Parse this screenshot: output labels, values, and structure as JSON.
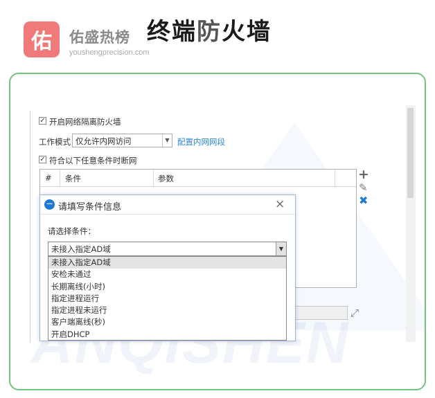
{
  "header": {
    "logo_char": "佑",
    "brand_name": "佑盛热榜",
    "brand_url": "youshengprecision.com",
    "title_prefix": "终端",
    "title_highlight": "防",
    "title_suffix": "火墙"
  },
  "watermark": {
    "text": "ANQISHEN"
  },
  "form": {
    "enable_checkbox": {
      "label": "开启网络隔离防火墙",
      "checked": true
    },
    "mode": {
      "label": "工作模式",
      "value": "仅允许内网访问"
    },
    "config_link": "配置内网网段",
    "disconnect_checkbox": {
      "label": "符合以下任意条件时断网",
      "checked": true
    },
    "grid": {
      "columns": [
        "#",
        "条件",
        "参数"
      ]
    },
    "toolbar": {
      "add": "+",
      "edit": "✎",
      "delete": "✖"
    }
  },
  "dialog": {
    "title": "请填写条件信息",
    "close": "×",
    "prompt": "请选择条件：",
    "selected": "未接入指定AD域",
    "options": [
      "未接入指定AD域",
      "安检未通过",
      "长期离线(小时)",
      "指定进程运行",
      "指定进程未运行",
      "客户端离线(秒)",
      "开启DHCP"
    ],
    "selected_index": 0
  },
  "colors": {
    "frame_border": "#74c480",
    "link": "#2a88d6",
    "delete_icon": "#1f7bd1",
    "logo_bg": "#f07a7a"
  }
}
